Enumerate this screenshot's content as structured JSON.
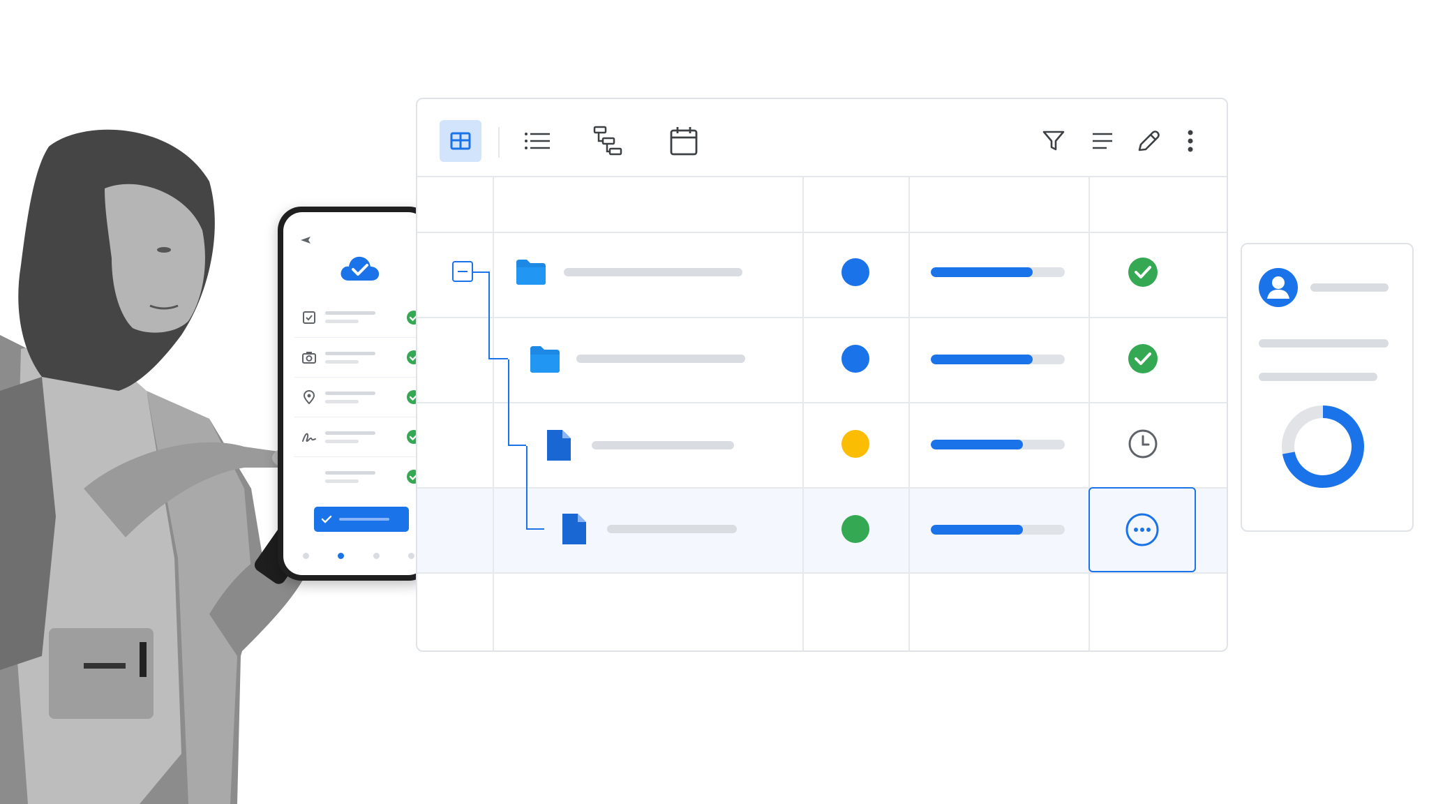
{
  "toolbar": {
    "views": [
      {
        "name": "grid-view",
        "icon": "grid-icon",
        "active": true
      },
      {
        "name": "list-view",
        "icon": "list-icon",
        "active": false
      },
      {
        "name": "hierarchy-view",
        "icon": "hierarchy-icon",
        "active": false
      },
      {
        "name": "calendar-view",
        "icon": "calendar-icon",
        "active": false
      }
    ],
    "actions": [
      "filter-icon",
      "sort-icon",
      "edit-icon",
      "more-vertical-icon"
    ]
  },
  "table": {
    "rows": [
      {
        "type": "folder",
        "indent": 0,
        "status_color": "#1a73e8",
        "progress": 0.76,
        "state": "complete"
      },
      {
        "type": "folder",
        "indent": 1,
        "status_color": "#1a73e8",
        "progress": 0.76,
        "state": "complete"
      },
      {
        "type": "document",
        "indent": 2,
        "status_color": "#fbbc04",
        "progress": 0.69,
        "state": "pending"
      },
      {
        "type": "document",
        "indent": 3,
        "status_color": "#34a853",
        "progress": 0.69,
        "state": "in-progress",
        "selected": true
      }
    ]
  },
  "phone": {
    "items": [
      "checkbox-icon",
      "camera-icon",
      "location-icon",
      "signature-icon",
      "blank-item"
    ],
    "pager": {
      "pages": 4,
      "active": 1
    }
  },
  "card": {
    "donut_fill": 0.72
  },
  "colors": {
    "accent": "#1a73e8",
    "success": "#34a853",
    "warning": "#fbbc04",
    "neutral": "#d9dce0"
  }
}
